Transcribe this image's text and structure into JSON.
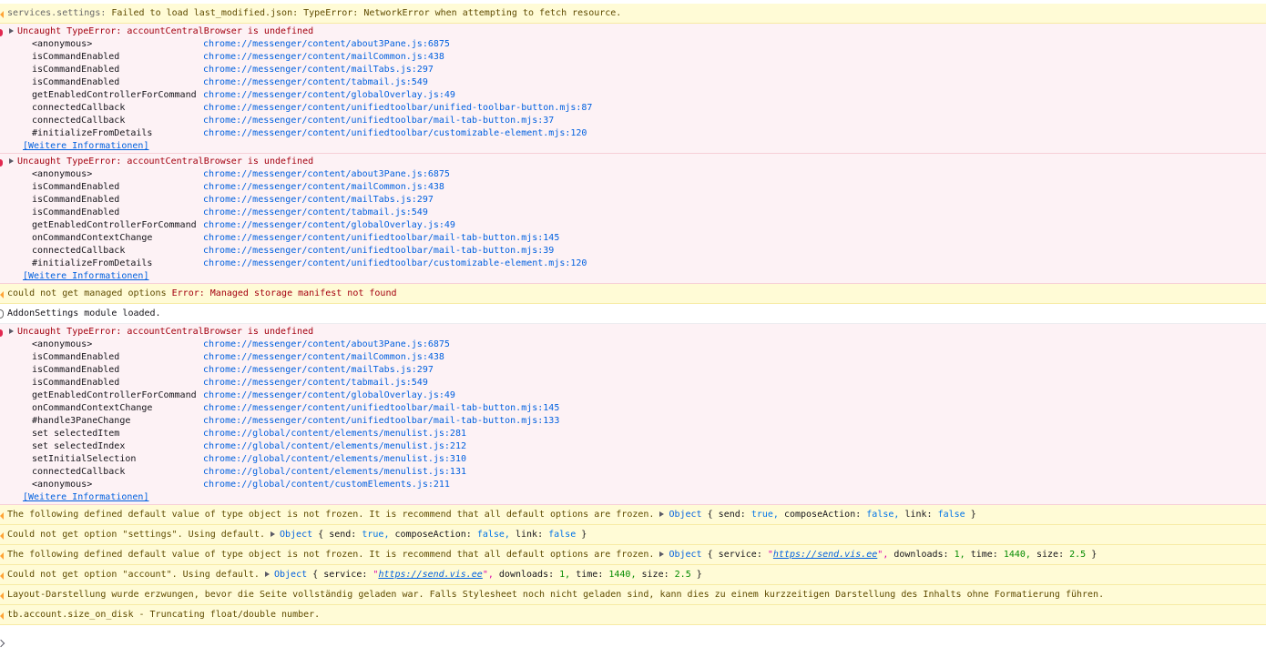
{
  "messages": {
    "m1": {
      "source": "services.settings:",
      "text": "Failed to load last_modified.json: TypeError: NetworkError when attempting to fetch resource."
    },
    "e1": {
      "title": "Uncaught TypeError: accountCentralBrowser is undefined",
      "frames": [
        {
          "fn": "<anonymous>",
          "loc": "chrome://messenger/content/about3Pane.js:6875"
        },
        {
          "fn": "isCommandEnabled",
          "loc": "chrome://messenger/content/mailCommon.js:438"
        },
        {
          "fn": "isCommandEnabled",
          "loc": "chrome://messenger/content/mailTabs.js:297"
        },
        {
          "fn": "isCommandEnabled",
          "loc": "chrome://messenger/content/tabmail.js:549"
        },
        {
          "fn": "getEnabledControllerForCommand",
          "loc": "chrome://messenger/content/globalOverlay.js:49"
        },
        {
          "fn": "connectedCallback",
          "loc": "chrome://messenger/content/unifiedtoolbar/unified-toolbar-button.mjs:87"
        },
        {
          "fn": "connectedCallback",
          "loc": "chrome://messenger/content/unifiedtoolbar/mail-tab-button.mjs:37"
        },
        {
          "fn": "#initializeFromDetails",
          "loc": "chrome://messenger/content/unifiedtoolbar/customizable-element.mjs:120"
        }
      ],
      "more": "[Weitere Informationen]"
    },
    "e2": {
      "title": "Uncaught TypeError: accountCentralBrowser is undefined",
      "frames": [
        {
          "fn": "<anonymous>",
          "loc": "chrome://messenger/content/about3Pane.js:6875"
        },
        {
          "fn": "isCommandEnabled",
          "loc": "chrome://messenger/content/mailCommon.js:438"
        },
        {
          "fn": "isCommandEnabled",
          "loc": "chrome://messenger/content/mailTabs.js:297"
        },
        {
          "fn": "isCommandEnabled",
          "loc": "chrome://messenger/content/tabmail.js:549"
        },
        {
          "fn": "getEnabledControllerForCommand",
          "loc": "chrome://messenger/content/globalOverlay.js:49"
        },
        {
          "fn": "onCommandContextChange",
          "loc": "chrome://messenger/content/unifiedtoolbar/mail-tab-button.mjs:145"
        },
        {
          "fn": "connectedCallback",
          "loc": "chrome://messenger/content/unifiedtoolbar/mail-tab-button.mjs:39"
        },
        {
          "fn": "#initializeFromDetails",
          "loc": "chrome://messenger/content/unifiedtoolbar/customizable-element.mjs:120"
        }
      ],
      "more": "[Weitere Informationen]"
    },
    "m2": {
      "text1": "could not get managed options",
      "text2": "Error: Managed storage manifest not found"
    },
    "m3": {
      "text": "AddonSettings module loaded."
    },
    "e3": {
      "title": "Uncaught TypeError: accountCentralBrowser is undefined",
      "frames": [
        {
          "fn": "<anonymous>",
          "loc": "chrome://messenger/content/about3Pane.js:6875"
        },
        {
          "fn": "isCommandEnabled",
          "loc": "chrome://messenger/content/mailCommon.js:438"
        },
        {
          "fn": "isCommandEnabled",
          "loc": "chrome://messenger/content/mailTabs.js:297"
        },
        {
          "fn": "isCommandEnabled",
          "loc": "chrome://messenger/content/tabmail.js:549"
        },
        {
          "fn": "getEnabledControllerForCommand",
          "loc": "chrome://messenger/content/globalOverlay.js:49"
        },
        {
          "fn": "onCommandContextChange",
          "loc": "chrome://messenger/content/unifiedtoolbar/mail-tab-button.mjs:145"
        },
        {
          "fn": "#handle3PaneChange",
          "loc": "chrome://messenger/content/unifiedtoolbar/mail-tab-button.mjs:133"
        },
        {
          "fn": "set selectedItem",
          "loc": "chrome://global/content/elements/menulist.js:281"
        },
        {
          "fn": "set selectedIndex",
          "loc": "chrome://global/content/elements/menulist.js:212"
        },
        {
          "fn": "setInitialSelection",
          "loc": "chrome://global/content/elements/menulist.js:310"
        },
        {
          "fn": "connectedCallback",
          "loc": "chrome://global/content/elements/menulist.js:131"
        },
        {
          "fn": "<anonymous>",
          "loc": "chrome://global/content/customElements.js:211"
        }
      ],
      "more": "[Weitere Informationen]"
    },
    "w4": {
      "text": "The following defined default value of type object is not frozen. It is recommend that all default options are frozen.",
      "obj": "Object",
      "ob": "{",
      "k1": "send:",
      "v1": "true,",
      "k2": "composeAction:",
      "v2": "false,",
      "k3": "link:",
      "v3": "false",
      "cb": "}"
    },
    "w5": {
      "text": "Could not get option \"settings\". Using default.",
      "obj": "Object",
      "ob": "{",
      "k1": "send:",
      "v1": "true,",
      "k2": "composeAction:",
      "v2": "false,",
      "k3": "link:",
      "v3": "false",
      "cb": "}"
    },
    "w6": {
      "text": "The following defined default value of type object is not frozen. It is recommend that all default options are frozen.",
      "obj": "Object",
      "ob": "{",
      "k1": "service:",
      "q1": "\"",
      "url": "https://send.vis.ee",
      "q2": "\",",
      "k2": "downloads:",
      "v2": "1,",
      "k3": "time:",
      "v3": "1440,",
      "k4": "size:",
      "v4": "2.5",
      "cb": "}"
    },
    "w7": {
      "text": "Could not get option \"account\". Using default.",
      "obj": "Object",
      "ob": "{",
      "k1": "service:",
      "q1": "\"",
      "url": "https://send.vis.ee",
      "q2": "\",",
      "k2": "downloads:",
      "v2": "1,",
      "k3": "time:",
      "v3": "1440,",
      "k4": "size:",
      "v4": "2.5",
      "cb": "}"
    },
    "w8": {
      "text": "Layout-Darstellung wurde erzwungen, bevor die Seite vollständig geladen war. Falls Stylesheet noch nicht geladen sind, kann dies zu einem kurzzeitigen Darstellung des Inhalts ohne Formatierung führen."
    },
    "w9": {
      "text": "tb.account.size_on_disk - Truncating float/double number."
    }
  },
  "colors": {
    "warning_bg": "#fffbd6",
    "error_bg": "#fdf2f5",
    "error_text": "#a4000f",
    "link": "#0060df",
    "number": "#058b00"
  }
}
